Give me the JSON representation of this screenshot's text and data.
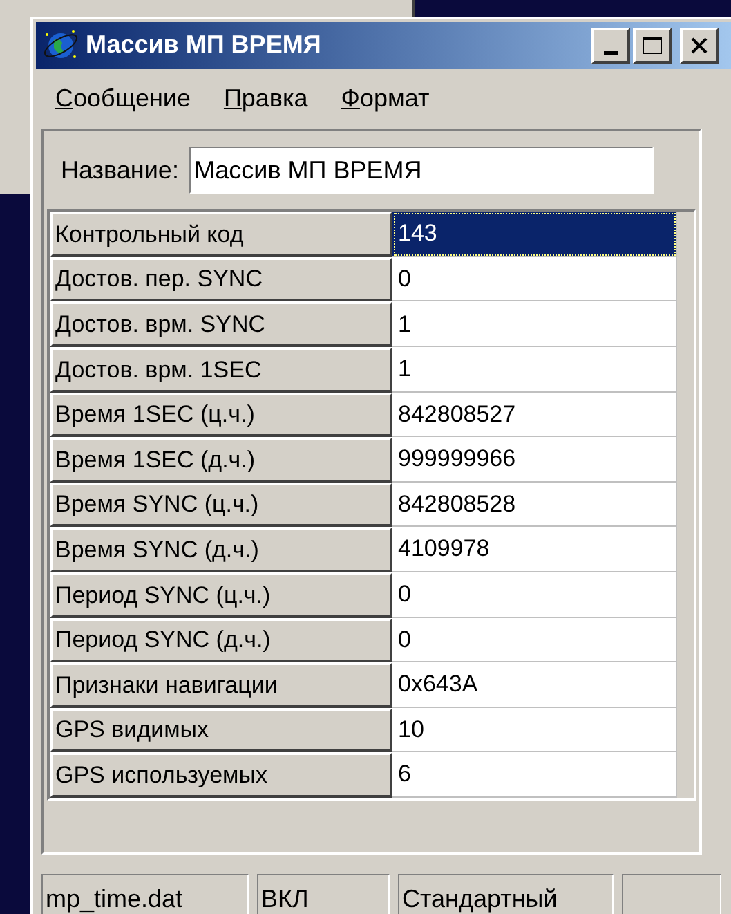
{
  "window": {
    "title": "Массив МП ВРЕМЯ"
  },
  "menu": [
    {
      "label": "Сообщение"
    },
    {
      "label": "Правка"
    },
    {
      "label": "Формат"
    }
  ],
  "name_field": {
    "label": "Название:",
    "value": "Массив МП ВРЕМЯ"
  },
  "rows": [
    {
      "label": "Контрольный код",
      "value": "143",
      "selected": true
    },
    {
      "label": "Достов. пер. SYNC",
      "value": "0",
      "selected": false
    },
    {
      "label": "Достов. врм. SYNC",
      "value": "1",
      "selected": false
    },
    {
      "label": "Достов. врм. 1SEC",
      "value": "1",
      "selected": false
    },
    {
      "label": "Время  1SEC (ц.ч.)",
      "value": "842808527",
      "selected": false
    },
    {
      "label": "Время  1SEC (д.ч.)",
      "value": "999999966",
      "selected": false
    },
    {
      "label": "Время  SYNC (ц.ч.)",
      "value": "842808528",
      "selected": false
    },
    {
      "label": "Время  SYNC (д.ч.)",
      "value": "4109978",
      "selected": false
    },
    {
      "label": "Период SYNC (ц.ч.)",
      "value": "0",
      "selected": false
    },
    {
      "label": "Период SYNC (д.ч.)",
      "value": "0",
      "selected": false
    },
    {
      "label": "Признаки навигации",
      "value": "0x643A",
      "selected": false
    },
    {
      "label": "GPS видимых",
      "value": "10",
      "selected": false
    },
    {
      "label": "GPS используемых",
      "value": "6",
      "selected": false
    }
  ],
  "status_bar": [
    "mp_time.dat",
    "ВКЛ",
    "Стандартный"
  ]
}
